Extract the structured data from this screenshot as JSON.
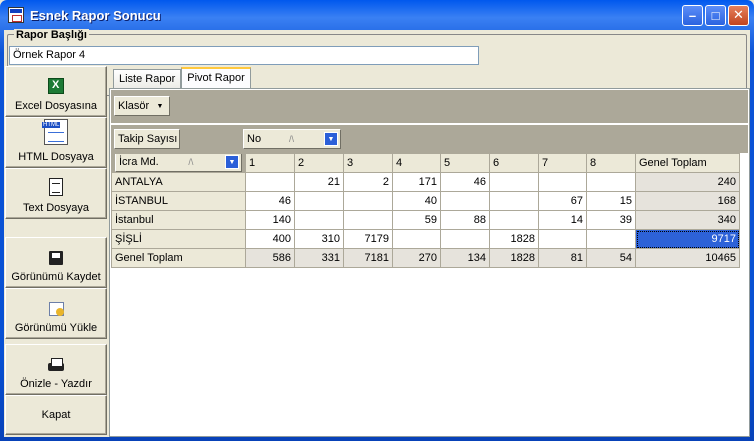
{
  "window": {
    "title": "Esnek Rapor Sonucu"
  },
  "report_header": {
    "legend": "Rapor Başlığı",
    "value": "Örnek Rapor 4"
  },
  "sidebar": {
    "buttons": [
      {
        "label": "Excel Dosyasına",
        "icon": "excel-icon"
      },
      {
        "label": "HTML Dosyaya",
        "icon": "html-icon"
      },
      {
        "label": "Text Dosyaya",
        "icon": "text-file-icon"
      },
      {
        "label": "Görünümü Kaydet",
        "icon": "save-icon"
      },
      {
        "label": "Görünümü Yükle",
        "icon": "load-icon"
      },
      {
        "label": "Önizle - Yazdır",
        "icon": "print-icon"
      },
      {
        "label": "Kapat",
        "icon": ""
      }
    ]
  },
  "tabs": [
    {
      "label": "Liste Rapor"
    },
    {
      "label": "Pivot Rapor"
    }
  ],
  "pivot": {
    "filter_field": "Klasör",
    "data_field": "Takip Sayısı",
    "column_field": "No",
    "row_field": "İcra Md.",
    "columns": [
      "1",
      "2",
      "3",
      "4",
      "5",
      "6",
      "7",
      "8",
      "Genel Toplam"
    ],
    "rows": [
      {
        "label": "ANTALYA",
        "cells": [
          "",
          "21",
          "2",
          "171",
          "46",
          "",
          "",
          "",
          "240"
        ]
      },
      {
        "label": "İSTANBUL",
        "cells": [
          "46",
          "",
          "",
          "40",
          "",
          "",
          "67",
          "15",
          "168"
        ]
      },
      {
        "label": "İstanbul",
        "cells": [
          "140",
          "",
          "",
          "59",
          "88",
          "",
          "14",
          "39",
          "340"
        ]
      },
      {
        "label": "ŞİŞLİ",
        "cells": [
          "400",
          "310",
          "7179",
          "",
          "",
          "1828",
          "",
          "",
          "9717"
        ]
      },
      {
        "label": "Genel Toplam",
        "cells": [
          "586",
          "331",
          "7181",
          "270",
          "134",
          "1828",
          "81",
          "54",
          "10465"
        ]
      }
    ]
  },
  "colors": {
    "selection": "#2d62d8",
    "field_area": "#aca899",
    "tab_highlight": "#ffc83c"
  }
}
